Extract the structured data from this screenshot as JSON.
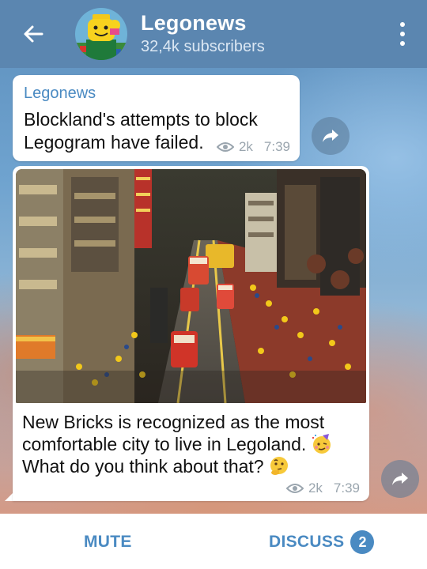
{
  "header": {
    "title": "Legonews",
    "subscribers": "32,4k subscribers",
    "back_icon": "arrow-left-icon",
    "menu_icon": "more-vertical-icon"
  },
  "messages": [
    {
      "author": "Legonews",
      "text": "Blockland's attempts to block Legogram have failed.",
      "views": "2k",
      "time": "7:39"
    },
    {
      "text_line1": "New Bricks is recognized as the most comfortable city to live in Legoland.",
      "text_line2": "What do you think about that?",
      "emoji1": "partying-face",
      "emoji2": "thinking-face",
      "views": "2k",
      "time": "7:39",
      "photo": "lego-city-street-photo"
    }
  ],
  "bottom": {
    "mute_label": "MUTE",
    "discuss_label": "DISCUSS",
    "discuss_count": "2"
  },
  "colors": {
    "header": "#5b86b0",
    "accent": "#4a8ac2",
    "meta": "#9aa5ae"
  }
}
